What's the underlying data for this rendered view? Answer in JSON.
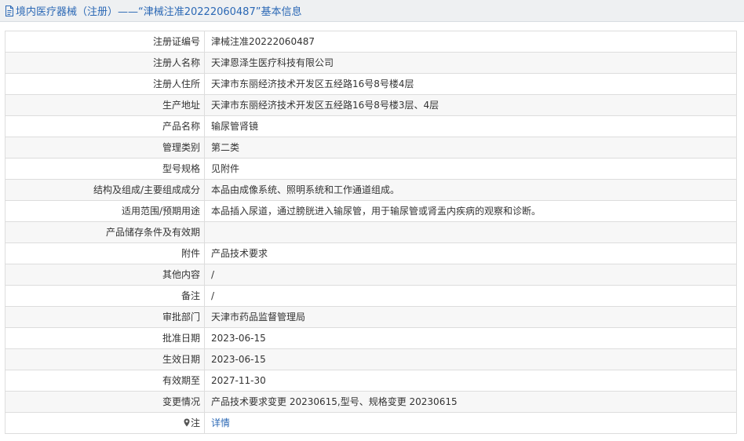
{
  "header": {
    "title": "境内医疗器械（注册）——“津械注准20222060487”基本信息"
  },
  "rows": [
    {
      "label": "注册证编号",
      "value": "津械注准20222060487"
    },
    {
      "label": "注册人名称",
      "value": "天津恩泽生医疗科技有限公司"
    },
    {
      "label": "注册人住所",
      "value": "天津市东丽经济技术开发区五经路16号8号楼4层"
    },
    {
      "label": "生产地址",
      "value": "天津市东丽经济技术开发区五经路16号8号楼3层、4层"
    },
    {
      "label": "产品名称",
      "value": "输尿管肾镜"
    },
    {
      "label": "管理类别",
      "value": "第二类"
    },
    {
      "label": "型号规格",
      "value": "见附件"
    },
    {
      "label": "结构及组成/主要组成成分",
      "value": "本品由成像系统、照明系统和工作通道组成。"
    },
    {
      "label": "适用范围/预期用途",
      "value": "本品插入尿道，通过膀胱进入输尿管，用于输尿管或肾盂内疾病的观察和诊断。"
    },
    {
      "label": "产品储存条件及有效期",
      "value": ""
    },
    {
      "label": "附件",
      "value": "产品技术要求"
    },
    {
      "label": "其他内容",
      "value": "/"
    },
    {
      "label": "备注",
      "value": "/"
    },
    {
      "label": "审批部门",
      "value": "天津市药品监督管理局"
    },
    {
      "label": "批准日期",
      "value": "2023-06-15"
    },
    {
      "label": "生效日期",
      "value": "2023-06-15"
    },
    {
      "label": "有效期至",
      "value": "2027-11-30"
    },
    {
      "label": "变更情况",
      "value": "产品技术要求变更 20230615,型号、规格变更 20230615"
    }
  ],
  "note_row": {
    "label": "注",
    "icon": "map-pin-icon",
    "link_text": "详情"
  },
  "colors": {
    "header_text": "#2b68b5",
    "header_bg": "#eef0f2",
    "link": "#2b68b5",
    "row_alt_bg": "#f7f7f7",
    "border": "#dddddd"
  }
}
